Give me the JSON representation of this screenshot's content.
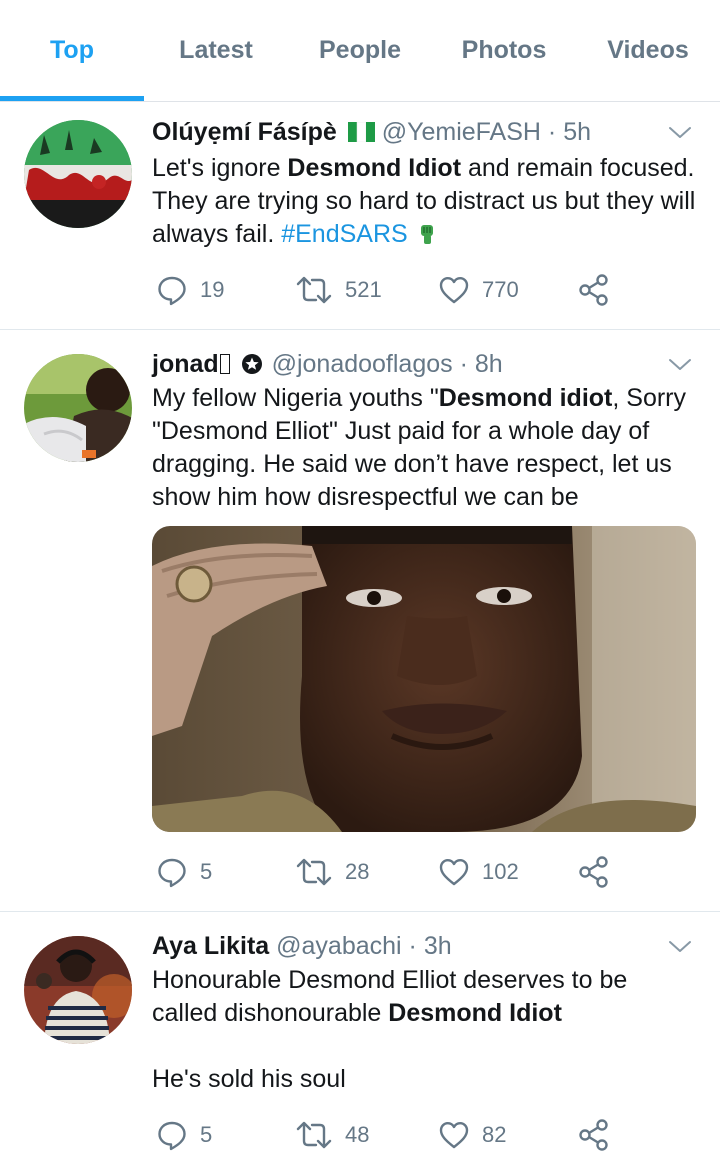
{
  "tabs": [
    {
      "label": "Top",
      "active": true
    },
    {
      "label": "Latest",
      "active": false
    },
    {
      "label": "People",
      "active": false
    },
    {
      "label": "Photos",
      "active": false
    },
    {
      "label": "Videos",
      "active": false
    }
  ],
  "colors": {
    "accent": "#1da1f2",
    "secondary_text": "#657786",
    "hashtag": "#1b95e0"
  },
  "tweets": [
    {
      "name": "Olúyẹmí Fásípè",
      "name_emoji": "nigeria-flag",
      "handle": "@YemieFASH",
      "dot": "·",
      "time": "5h",
      "text_1": "Let's ignore ",
      "bold_1": "Desmond Idiot",
      "text_2": " and remain focused. They are trying so hard to distract us but they will always fail.  ",
      "hashtag": "#EndSARS",
      "trailing_emoji": "raised-fist-icon",
      "replies": "19",
      "retweets": "521",
      "likes": "770"
    },
    {
      "name": "jonad",
      "name_glyph": "",
      "handle": "@jonadooflagos",
      "dot": "·",
      "time": "8h",
      "text_1": "My fellow Nigeria youths \"",
      "bold_1": "Desmond idiot",
      "text_2": ", Sorry \"Desmond Elliot\"  Just paid for a whole day of dragging.  He said we don’t have respect, let us show him how disrespectful we can be",
      "media": "photo-saluting-man",
      "replies": "5",
      "retweets": "28",
      "likes": "102"
    },
    {
      "name": "Aya Likita",
      "handle": "@ayabachi",
      "dot": "·",
      "time": "3h",
      "text_1": "Honourable Desmond Elliot deserves to be called dishonourable ",
      "bold_1": "Desmond Idiot",
      "text_2": "He's sold his soul",
      "replies": "5",
      "retweets": "48",
      "likes": "82"
    }
  ]
}
